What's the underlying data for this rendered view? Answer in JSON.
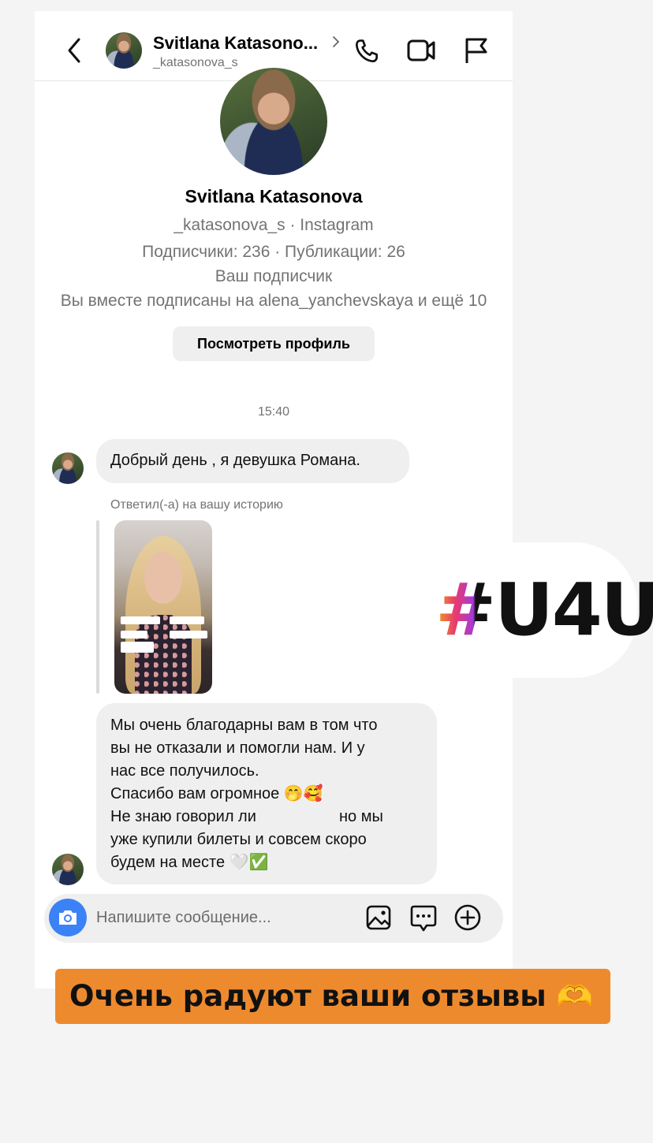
{
  "header": {
    "name": "Svitlana Katasono...",
    "username": "_katasonova_s"
  },
  "profile": {
    "name": "Svitlana Katasonova",
    "handle_line": "_katasonova_s · Instagram",
    "stats": "Подписчики: 236 · Публикации: 26",
    "follow_status": "Ваш подписчик",
    "mutual": "Вы вместе подписаны на alena_yanchevskaya и ещё 10",
    "view_profile_label": "Посмотреть профиль"
  },
  "chat": {
    "timestamp": "15:40",
    "message1": "Добрый день , я девушка Романа.",
    "story_reply_label": "Ответил(-а) на вашу историю",
    "message2": {
      "line1": "Мы очень благодарны вам в том что",
      "line2": "вы не отказали и помогли нам.  И у",
      "line3": "нас все получилось.",
      "line4": "Спасибо вам огромное 🤭🥰",
      "line5a": "Не знаю говорил ли",
      "line5b": "но мы",
      "line6": "уже купили билеты и совсем скоро",
      "line7": "будем на месте 🤍✅"
    }
  },
  "composer": {
    "placeholder": "Напишите сообщение..."
  },
  "overlay": {
    "hashtag": "#U4U",
    "banner_text": "Очень радуют ваши отзывы 🫶"
  },
  "colors": {
    "accent_blue": "#3b82f6",
    "banner_orange": "#ee8a2e",
    "bubble_gray": "#efefef"
  },
  "icons": [
    "back-chevron-icon",
    "phone-icon",
    "video-icon",
    "flag-icon",
    "camera-icon",
    "gallery-icon",
    "sticker-icon",
    "plus-icon"
  ]
}
